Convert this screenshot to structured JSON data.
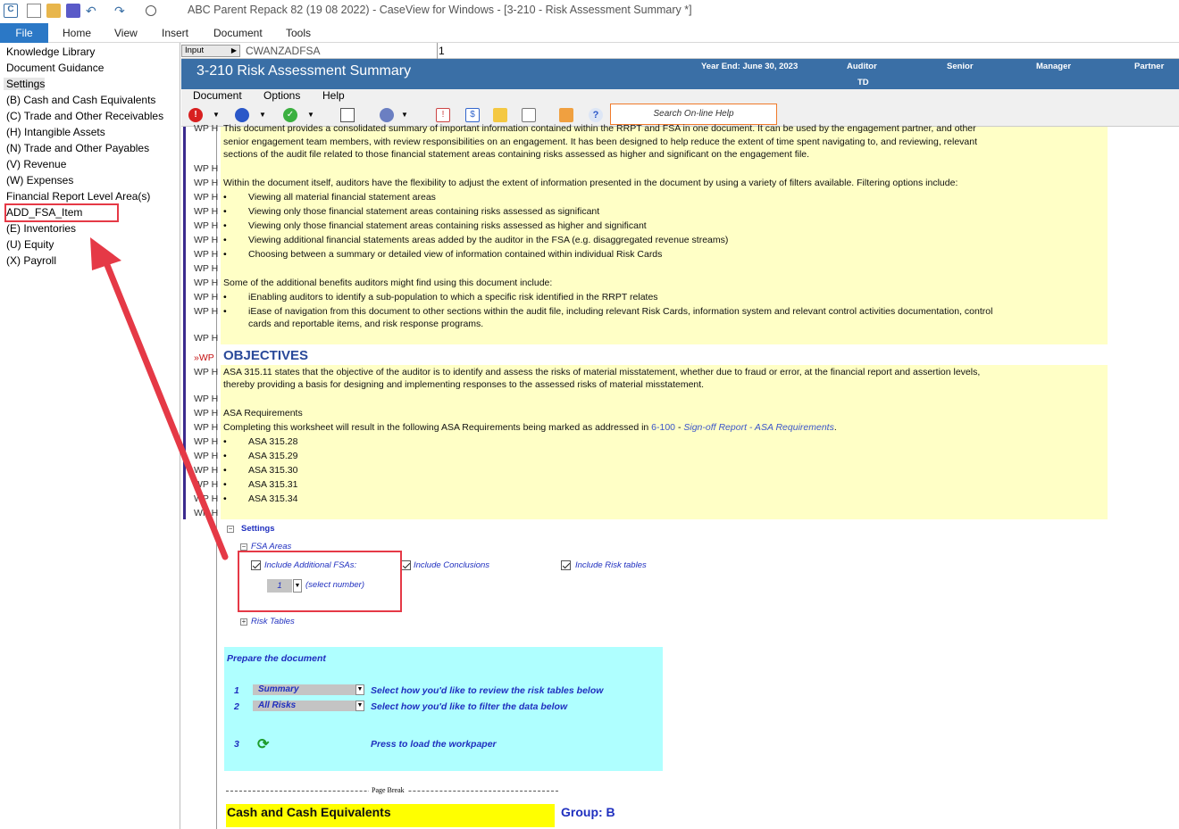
{
  "app": {
    "title": "ABC Parent Repack 82 (19 08 2022) - CaseView for Windows - [3-210 - Risk Assessment Summary *]"
  },
  "ribbon": {
    "tabs": [
      "File",
      "Home",
      "View",
      "Insert",
      "Document",
      "Tools"
    ]
  },
  "left_pane": {
    "items": [
      "Knowledge Library",
      "Document Guidance",
      "Settings",
      "(B) Cash and Cash Equivalents",
      "(C) Trade and Other Receivables",
      "(H) Intangible Assets",
      "(N) Trade and Other Payables",
      "(V) Revenue",
      "(W) Expenses",
      "Financial Report Level Area(s)",
      "ADD_FSA_Item",
      "(E) Inventories",
      "(U) Equity",
      "(X) Payroll"
    ]
  },
  "input_bar": {
    "mode": "Input",
    "cell_ref": "CWANZADFSA",
    "value": "1"
  },
  "doc_header": {
    "title": "3-210 Risk Assessment Summary",
    "year_end": "Year End: June 30, 2023",
    "roles": [
      "Auditor",
      "Senior",
      "Manager",
      "Partner"
    ],
    "auditor_initials": "TD"
  },
  "doc_menu": [
    "Document",
    "Options",
    "Help"
  ],
  "toolbar": {
    "search_placeholder": "Search On-line Help"
  },
  "body": {
    "intro_line1": "This document provides a consolidated summary of important information contained within the RRPT and FSA in one document. It can be used by the engagement partner, and other",
    "intro_line2": "senior engagement team members, with review responsibilities on an engagement. It has been designed to help reduce the extent of time spent navigating to, and reviewing, relevant",
    "intro_line3": "sections of the audit file related to those financial statement areas containing risks assessed as higher and significant on the engagement file.",
    "filter_intro": "Within the document itself, auditors have the flexibility to adjust the extent of information presented in the document by using a variety of filters available. Filtering options include:",
    "filters": [
      "Viewing all material financial statement areas",
      "Viewing only those financial statement areas containing risks assessed as significant",
      "Viewing only those financial statement areas containing risks assessed as higher and significant",
      "Viewing additional financial statements areas added by the auditor in the FSA (e.g. disaggregated revenue streams)",
      "Choosing between a summary or detailed view of information contained within individual Risk Cards"
    ],
    "benefits_intro": "Some of the additional benefits auditors might find using this document include:",
    "benefit1": "iEnabling auditors to identify a sub-population to which a specific risk identified in the RRPT relates",
    "benefit2a": "iEase of navigation from this document to other sections within the audit file, including relevant Risk Cards, information system and relevant control activities documentation, control",
    "benefit2b": "cards and reportable items, and risk response programs.",
    "objectives_heading": "OBJECTIVES",
    "obj_line1": "ASA 315.11 states that the objective of the auditor is to identify and assess the risks of material misstatement, whether due to fraud or error, at the financial report and assertion levels,",
    "obj_line2": "thereby providing a basis for designing and implementing responses to the assessed risks of material misstatement.",
    "asa_req_heading": "ASA Requirements",
    "asa_req_text": "Completing this worksheet will result in the following ASA Requirements being marked as addressed in",
    "asa_req_ref": "6-100",
    "asa_req_link": "Sign-off Report - ASA Requirements",
    "asa_items": [
      "ASA 315.28",
      "ASA 315.29",
      "ASA 315.30",
      "ASA 315.31",
      "ASA 315.34"
    ],
    "wp_label": "WP H",
    "wp_marker": "»WP"
  },
  "settings": {
    "heading": "Settings",
    "fsa_areas": "FSA Areas",
    "include_additional": "Include Additional FSAs:",
    "include_conclusions": "Include Conclusions",
    "include_risk_tables": "Include Risk tables",
    "select_value": "1",
    "select_hint": "(select number)",
    "risk_tables": "Risk Tables"
  },
  "prepare": {
    "title": "Prepare the document",
    "step1_num": "1",
    "step1_value": "Summary",
    "step1_desc": "Select how you'd like to review the risk tables below",
    "step2_num": "2",
    "step2_value": "All Risks",
    "step2_desc": "Select how you'd like to filter the data below",
    "step3_num": "3",
    "step3_desc": "Press to load the workpaper"
  },
  "page_break": "Page Break",
  "section": {
    "title": "Cash and Cash Equivalents",
    "group": "Group: B"
  },
  "colors": {
    "header_blue": "#3a6fa6",
    "note_yellow": "#ffffc6",
    "prep_cyan": "#afffff",
    "highlight_red": "#e53946"
  }
}
